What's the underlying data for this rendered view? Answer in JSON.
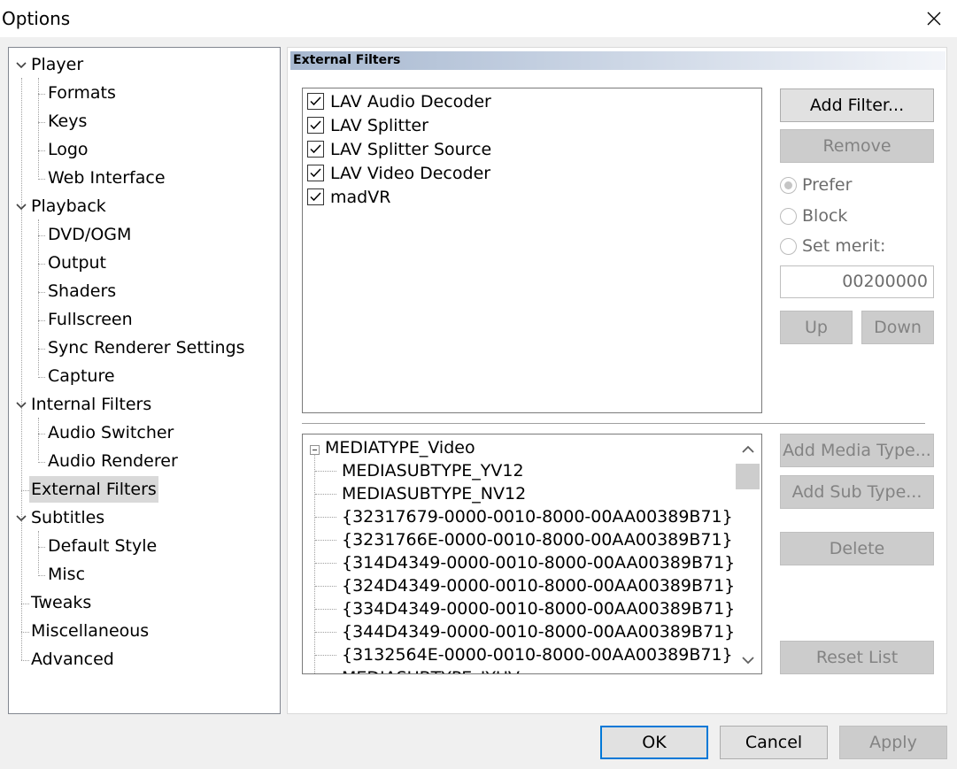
{
  "window": {
    "title": "Options"
  },
  "tree": {
    "items": [
      {
        "label": "Player",
        "level": 0,
        "expanded": true
      },
      {
        "label": "Formats",
        "level": 1
      },
      {
        "label": "Keys",
        "level": 1
      },
      {
        "label": "Logo",
        "level": 1
      },
      {
        "label": "Web Interface",
        "level": 1
      },
      {
        "label": "Playback",
        "level": 0,
        "expanded": true
      },
      {
        "label": "DVD/OGM",
        "level": 1
      },
      {
        "label": "Output",
        "level": 1
      },
      {
        "label": "Shaders",
        "level": 1
      },
      {
        "label": "Fullscreen",
        "level": 1
      },
      {
        "label": "Sync Renderer Settings",
        "level": 1
      },
      {
        "label": "Capture",
        "level": 1
      },
      {
        "label": "Internal Filters",
        "level": 0,
        "expanded": true
      },
      {
        "label": "Audio Switcher",
        "level": 1
      },
      {
        "label": "Audio Renderer",
        "level": 1
      },
      {
        "label": "External Filters",
        "level": 0,
        "selected": true
      },
      {
        "label": "Subtitles",
        "level": 0,
        "expanded": true
      },
      {
        "label": "Default Style",
        "level": 1
      },
      {
        "label": "Misc",
        "level": 1
      },
      {
        "label": "Tweaks",
        "level": 0
      },
      {
        "label": "Miscellaneous",
        "level": 0
      },
      {
        "label": "Advanced",
        "level": 0
      }
    ]
  },
  "page": {
    "header": "External Filters",
    "filters": [
      {
        "label": "LAV Audio Decoder",
        "checked": true
      },
      {
        "label": "LAV Splitter",
        "checked": true
      },
      {
        "label": "LAV Splitter Source",
        "checked": true
      },
      {
        "label": "LAV Video Decoder",
        "checked": true
      },
      {
        "label": "madVR",
        "checked": true
      }
    ],
    "buttons": {
      "add_filter": "Add Filter...",
      "remove": "Remove",
      "up": "Up",
      "down": "Down",
      "add_media_type": "Add Media Type...",
      "add_sub_type": "Add Sub Type...",
      "delete": "Delete",
      "reset_list": "Reset List"
    },
    "radios": {
      "prefer": "Prefer",
      "block": "Block",
      "set_merit": "Set merit:",
      "selected": "prefer"
    },
    "merit_value": "00200000",
    "media_tree": {
      "root": "MEDIATYPE_Video",
      "children": [
        "MEDIASUBTYPE_YV12",
        "MEDIASUBTYPE_NV12",
        "{32317679-0000-0010-8000-00AA00389B71}",
        "{3231766E-0000-0010-8000-00AA00389B71}",
        "{314D4349-0000-0010-8000-00AA00389B71}",
        "{324D4349-0000-0010-8000-00AA00389B71}",
        "{334D4349-0000-0010-8000-00AA00389B71}",
        "{344D4349-0000-0010-8000-00AA00389B71}",
        "{3132564E-0000-0010-8000-00AA00389B71}",
        "MEDIASUBTYPE_IYUV"
      ]
    }
  },
  "footer": {
    "ok": "OK",
    "cancel": "Cancel",
    "apply": "Apply"
  },
  "colors": {
    "accent": "#0078d7",
    "header_gradient_start": "#a7b8d0",
    "selection": "#d9d9d9"
  }
}
